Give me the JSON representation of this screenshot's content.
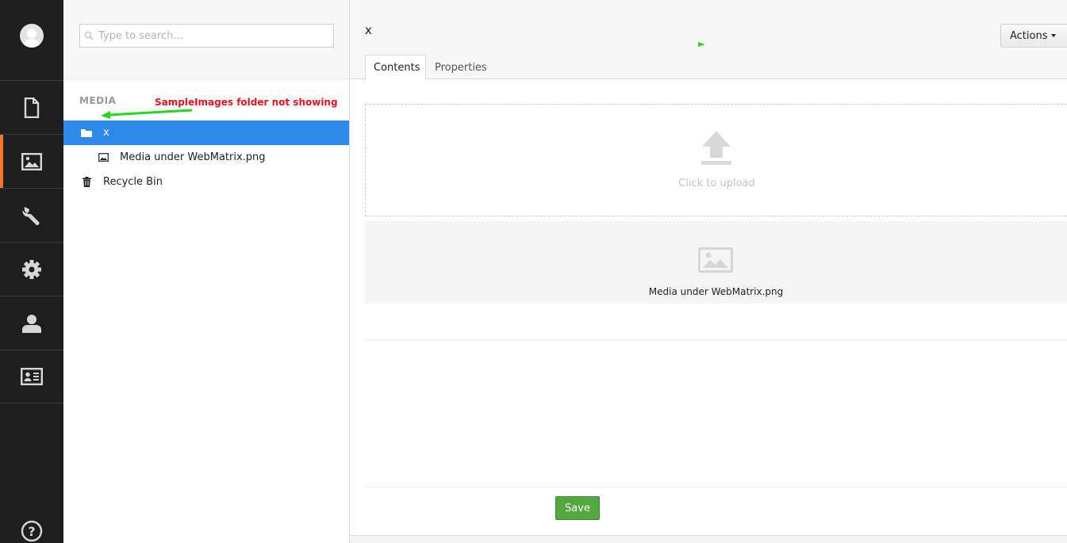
{
  "sections": [
    {
      "name": "content",
      "icon": "document-icon",
      "active": false
    },
    {
      "name": "media",
      "icon": "image-icon",
      "active": true
    },
    {
      "name": "developer",
      "icon": "wrench-icon",
      "active": false
    },
    {
      "name": "settings",
      "icon": "gear-icon",
      "active": false
    },
    {
      "name": "users",
      "icon": "user-icon",
      "active": false
    },
    {
      "name": "members",
      "icon": "id-card-icon",
      "active": false
    }
  ],
  "search": {
    "placeholder": "Type to search..."
  },
  "tree": {
    "title": "MEDIA",
    "items": [
      {
        "label": "x",
        "icon": "folder-icon"
      },
      {
        "label": "Media under WebMatrix.png",
        "icon": "image-icon"
      },
      {
        "label": "Recycle Bin",
        "icon": "trash-icon"
      }
    ]
  },
  "annotation": {
    "text": "SampleImages folder not showing",
    "color": "#e8111d",
    "arrow_color": "#1fdb1f"
  },
  "editor": {
    "node_name": "x",
    "actions_label": "Actions",
    "tabs": [
      {
        "label": "Contents"
      },
      {
        "label": "Properties"
      }
    ],
    "upload_text": "Click to upload",
    "media_items": [
      {
        "name": "Media under WebMatrix.png"
      }
    ],
    "save_label": "Save"
  },
  "colors": {
    "sidebar_bg": "#1e1e1e",
    "active_section": "#f5762a",
    "selected_row": "#2e8aea",
    "save_button": "#53a93f"
  }
}
